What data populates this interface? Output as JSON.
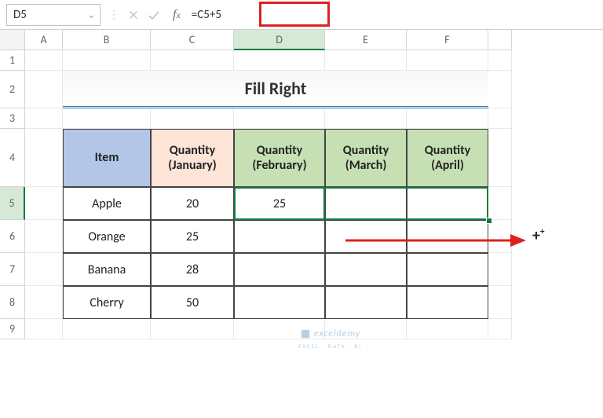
{
  "nameBox": {
    "value": "D5"
  },
  "formulaBar": {
    "value": "=C5+5"
  },
  "columns": [
    "A",
    "B",
    "C",
    "D",
    "E",
    "F"
  ],
  "rows": [
    "1",
    "2",
    "3",
    "4",
    "5",
    "6",
    "7",
    "8",
    "9"
  ],
  "activeColumn": "D",
  "activeRow": "5",
  "title": "Fill Right",
  "headers": {
    "item": "Item",
    "jan": "Quantity (January)",
    "feb": "Quantity (February)",
    "mar": "Quantity (March)",
    "apr": "Quantity (April)"
  },
  "data": {
    "items": [
      "Apple",
      "Orange",
      "Banana",
      "Cherry"
    ],
    "jan": [
      "20",
      "25",
      "28",
      "50"
    ],
    "feb": [
      "25",
      "",
      "",
      ""
    ]
  },
  "watermark": {
    "brand": "exceldemy",
    "tag": "EXCEL · DATA · BI"
  },
  "chart_data": {
    "type": "table",
    "title": "Fill Right",
    "columns": [
      "Item",
      "Quantity (January)",
      "Quantity (February)",
      "Quantity (March)",
      "Quantity (April)"
    ],
    "rows": [
      [
        "Apple",
        20,
        25,
        null,
        null
      ],
      [
        "Orange",
        25,
        null,
        null,
        null
      ],
      [
        "Banana",
        28,
        null,
        null,
        null
      ],
      [
        "Cherry",
        50,
        null,
        null,
        null
      ]
    ],
    "active_cell": "D5",
    "formula": "=C5+5",
    "fill_range": "D5:F5"
  }
}
